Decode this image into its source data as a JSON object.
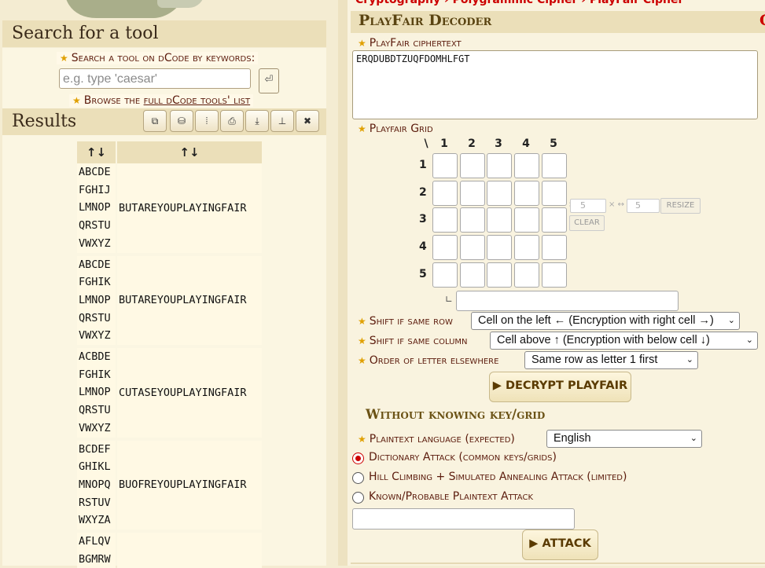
{
  "breadcrumb": "Cryptography › Polygrammic Cipher › PlayFair Cipher",
  "left": {
    "search_title": "Search for a tool",
    "search_label": "Search a tool on dCode by keywords:",
    "search_placeholder": "e.g. type 'caesar'",
    "search_go": "⏎",
    "browse_prefix": "Browse the ",
    "browse_link": "full dCode tools' list",
    "results_title": "Results",
    "toolbar_icons": [
      "copy-icon",
      "save-icon",
      "columns-icon",
      "print-icon",
      "download-icon",
      "pin-icon",
      "close-icon"
    ],
    "toolbar_glyphs": [
      "⧉",
      "⛁",
      "⦙",
      "⎙",
      "⤓",
      "⊥",
      "✖"
    ],
    "headers": [
      "↑↓",
      "↑↓"
    ],
    "results": [
      {
        "grid": [
          "ABCDE",
          "FGHIJ",
          "LMNOP",
          "QRSTU",
          "VWXYZ"
        ],
        "plain": "BUTAREYOUPLAYINGFAIR"
      },
      {
        "grid": [
          "ABCDE",
          "FGHIK",
          "LMNOP",
          "QRSTU",
          "VWXYZ"
        ],
        "plain": "BUTAREYOUPLAYINGFAIR"
      },
      {
        "grid": [
          "ACBDE",
          "FGHIK",
          "LMNOP",
          "QRSTU",
          "VWXYZ"
        ],
        "plain": "CUTASEYOUPLAYINGFAIR"
      },
      {
        "grid": [
          "BCDEF",
          "GHIKL",
          "MNOPQ",
          "RSTUV",
          "WXYZA"
        ],
        "plain": "BUOFREYOUPLAYINGFAIR"
      },
      {
        "grid": [
          "AFLQV",
          "BGMRW"
        ],
        "plain": ""
      }
    ]
  },
  "tool": {
    "title": "PlayFair Decoder",
    "title_cut": "C",
    "cipher_label": "PlayFair ciphertext",
    "ciphertext": "ERQDUBDTZUQFDOMHLFGT",
    "grid_label": "Playfair Grid",
    "grid_corner": "\\",
    "grid_cols": [
      "1",
      "2",
      "3",
      "4",
      "5"
    ],
    "grid_rows": [
      "1",
      "2",
      "3",
      "4",
      "5"
    ],
    "grid_rows_value": "5",
    "grid_cols_value": "5",
    "grid_x": "×",
    "resize": "RESIZE",
    "clear": "CLEAR",
    "shift_row_label": "Shift if same row",
    "shift_row_value": "Cell on the left ← (Encryption with right cell →)",
    "shift_col_label": "Shift if same column",
    "shift_col_value": "Cell above ↑ (Encryption with below cell ↓)",
    "order_label": "Order of letter elsewhere",
    "order_value": "Same row as letter 1 first",
    "decrypt_button": "▶ DECRYPT PLAYFAIR",
    "without_title": "Without knowing key/grid",
    "lang_label": "Plaintext language (expected)",
    "lang_value": "English",
    "attacks": [
      {
        "label": "Dictionary Attack (common keys/grids)",
        "checked": true
      },
      {
        "label": "Hill Climbing + Simulated Annealing Attack (limited)",
        "checked": false
      },
      {
        "label": "Known/Probable Plaintext Attack",
        "checked": false
      }
    ],
    "attack_button": "▶ ATTACK"
  }
}
